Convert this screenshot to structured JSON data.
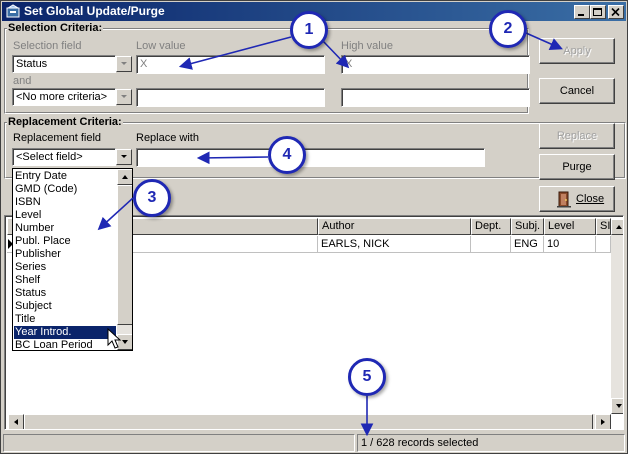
{
  "window": {
    "title": "Set Global Update/Purge",
    "icon": "purge-app-icon",
    "controls": [
      "minimize-icon",
      "maximize-icon",
      "close-icon"
    ]
  },
  "selection": {
    "heading": "Selection Criteria:",
    "field_label": "Selection field",
    "low_label": "Low value",
    "high_label": "High value",
    "field_value": "Status",
    "low_value": "X",
    "high_value": "X",
    "and_label": "and",
    "field2_value": "<No more criteria>",
    "low2_value": "",
    "high2_value": ""
  },
  "replacement": {
    "heading": "Replacement Criteria:",
    "field_label": "Replacement field",
    "with_label": "Replace with",
    "field_value": "<Select field>",
    "with_value": ""
  },
  "buttons": {
    "apply": "Apply",
    "cancel": "Cancel",
    "replace": "Replace",
    "purge": "Purge",
    "close": "Close"
  },
  "dropdown": {
    "options": [
      "Entry Date",
      "GMD (Code)",
      "ISBN",
      "Level",
      "Number",
      "Publ. Place",
      "Publisher",
      "Series",
      "Shelf",
      "Status",
      "Subject",
      "Title",
      "Year Introd.",
      "BC Loan Period"
    ],
    "highlighted": "Year Introd."
  },
  "grid": {
    "columns": [
      "Author",
      "Dept.",
      "Subj.",
      "Level",
      "SI"
    ],
    "rows": [
      {
        "author": "EARLS, NICK",
        "dept": "",
        "subj": "ENG",
        "level": "10",
        "si": ""
      }
    ]
  },
  "status": {
    "left": "",
    "records": "1 / 628 records selected"
  },
  "callouts": [
    "1",
    "2",
    "3",
    "4",
    "5"
  ],
  "colors": {
    "callout": "#1f28b4",
    "titlebar": "#0a246a",
    "highlight": "#0a246a"
  }
}
